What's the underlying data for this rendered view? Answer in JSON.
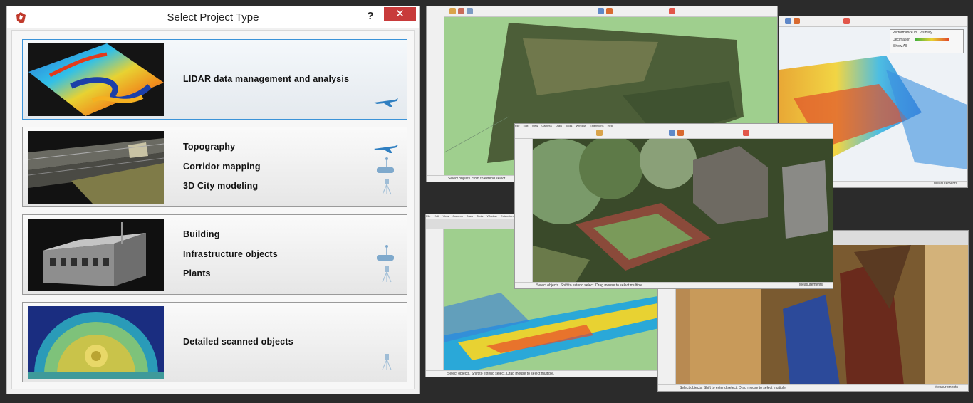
{
  "dialog": {
    "title": "Select Project Type",
    "help_label": "?",
    "close_label": "✕"
  },
  "cards": [
    {
      "labels": [
        "LIDAR data management and analysis"
      ],
      "icons": [
        "airplane-icon"
      ],
      "selected": true
    },
    {
      "labels": [
        "Topography",
        "Corridor mapping",
        "3D City modeling"
      ],
      "icons": [
        "airplane-icon",
        "mobile-scanner-car-icon",
        "tripod-scanner-icon"
      ],
      "selected": false
    },
    {
      "labels": [
        "Building",
        "Infrastructure objects",
        "Plants"
      ],
      "icons": [
        "mobile-scanner-car-icon",
        "tripod-scanner-icon"
      ],
      "selected": false
    },
    {
      "labels": [
        "Detailed scanned objects"
      ],
      "icons": [
        "tripod-scanner-icon"
      ],
      "selected": false
    }
  ],
  "sketchup_windows": {
    "menu_items": [
      "File",
      "Edit",
      "View",
      "Camera",
      "Draw",
      "Tools",
      "Window",
      "Extensions",
      "Help"
    ],
    "status_text": "Select objects. Shift to extend select. Drag mouse to select multiple.",
    "status_text_short": "Select objects. Shift to extend select.",
    "measurements_label": "Measurements",
    "performance_panel": {
      "title": "Performance vs. Visibility",
      "decimation_label": "Decimation",
      "show_all_label": "Show All"
    }
  },
  "colors": {
    "accent_selected": "#3b93d8",
    "close_button": "#c83b3b",
    "dialog_bg": "#f0f0f0",
    "sketchup_sky": "#9fcf8e"
  }
}
